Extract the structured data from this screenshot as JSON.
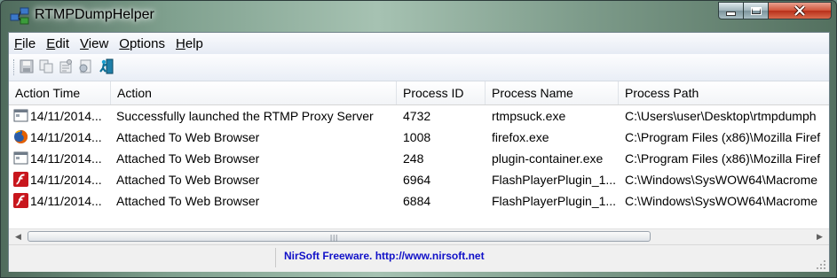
{
  "window": {
    "title": "RTMPDumpHelper",
    "icon": "app-network-icon"
  },
  "caption_buttons": {
    "minimize": "minimize",
    "maximize": "maximize",
    "close": "close"
  },
  "menu": [
    {
      "label": "File",
      "accel": "F",
      "rest": "ile"
    },
    {
      "label": "Edit",
      "accel": "E",
      "rest": "dit"
    },
    {
      "label": "View",
      "accel": "V",
      "rest": "iew"
    },
    {
      "label": "Options",
      "accel": "O",
      "rest": "ptions"
    },
    {
      "label": "Help",
      "accel": "H",
      "rest": "elp"
    }
  ],
  "toolbar": [
    "save-icon",
    "copy-icon",
    "properties-icon",
    "html-report-icon",
    "exit-icon"
  ],
  "columns": [
    "Action Time",
    "Action",
    "Process ID",
    "Process Name",
    "Process Path"
  ],
  "rows": [
    {
      "icon": "window-app-icon",
      "time": "14/11/2014...",
      "action": "Successfully launched the RTMP Proxy Server",
      "pid": "4732",
      "name": "rtmpsuck.exe",
      "path": "C:\\Users\\user\\Desktop\\rtmpdumph"
    },
    {
      "icon": "firefox-icon",
      "time": "14/11/2014...",
      "action": "Attached To Web Browser",
      "pid": "1008",
      "name": "firefox.exe",
      "path": "C:\\Program Files (x86)\\Mozilla Firef"
    },
    {
      "icon": "window-app-icon",
      "time": "14/11/2014...",
      "action": "Attached To Web Browser",
      "pid": "248",
      "name": "plugin-container.exe",
      "path": "C:\\Program Files (x86)\\Mozilla Firef"
    },
    {
      "icon": "flash-icon",
      "time": "14/11/2014...",
      "action": "Attached To Web Browser",
      "pid": "6964",
      "name": "FlashPlayerPlugin_1...",
      "path": "C:\\Windows\\SysWOW64\\Macrome"
    },
    {
      "icon": "flash-icon",
      "time": "14/11/2014...",
      "action": "Attached To Web Browser",
      "pid": "6884",
      "name": "FlashPlayerPlugin_1...",
      "path": "C:\\Windows\\SysWOW64\\Macrome"
    }
  ],
  "status": {
    "left": "",
    "link": "NirSoft Freeware.  http://www.nirsoft.net"
  },
  "colors": {
    "link": "#1010c8",
    "flash_red": "#c8161d",
    "firefox_orange": "#e66000"
  }
}
